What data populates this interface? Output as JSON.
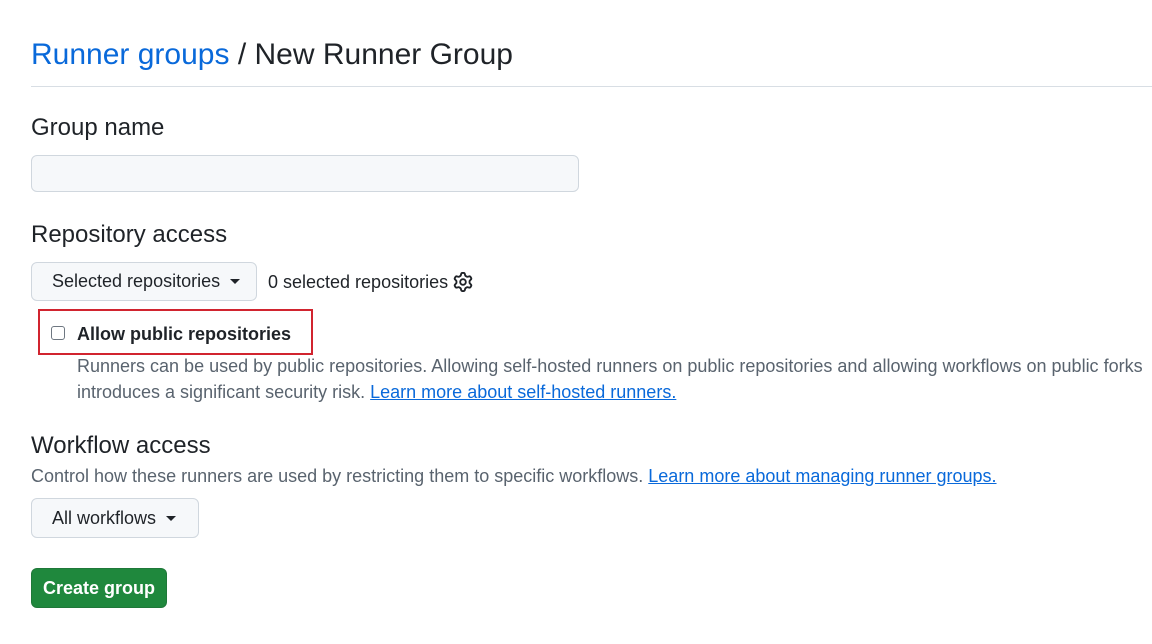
{
  "breadcrumb": {
    "parent_label": "Runner groups",
    "separator": "/",
    "current_label": "New Runner Group"
  },
  "group_name": {
    "label": "Group name",
    "value": "",
    "placeholder": ""
  },
  "repository_access": {
    "label": "Repository access",
    "dropdown_label": "Selected repositories",
    "selected_count_text": "0 selected repositories",
    "settings_icon": "gear-icon",
    "allow_public": {
      "label": "Allow public repositories",
      "checked": false,
      "note_line1": "Runners can be used by public repositories. Allowing self-hosted runners on public repositories and allowing workflows on public forks",
      "note_line2": "introduces a significant security risk.",
      "note_link": "Learn more about self-hosted runners."
    }
  },
  "workflow_access": {
    "label": "Workflow access",
    "description": "Control how these runners are used by restricting them to specific workflows.",
    "description_link": "Learn more about managing runner groups.",
    "dropdown_label": "All workflows"
  },
  "actions": {
    "create_label": "Create group"
  },
  "colors": {
    "link": "#0969da",
    "primary_button": "#1f883d",
    "highlight_border": "#d1242f"
  }
}
